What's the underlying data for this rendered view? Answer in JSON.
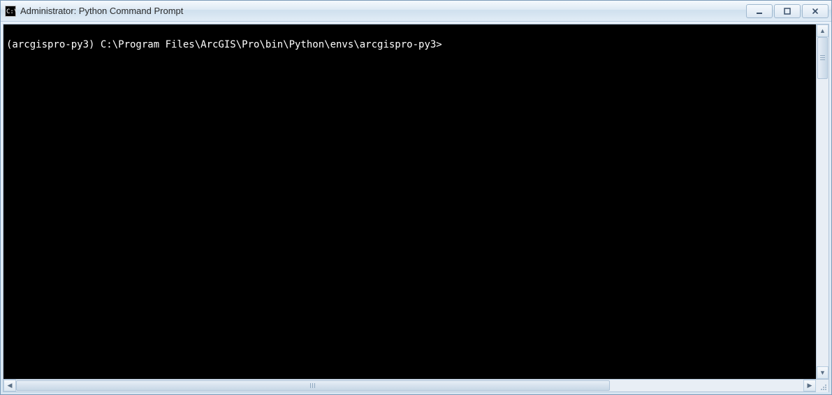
{
  "titlebar": {
    "title": "Administrator: Python Command Prompt"
  },
  "console": {
    "prompt": "(arcgispro-py3) C:\\Program Files\\ArcGIS\\Pro\\bin\\Python\\envs\\arcgispro-py3>"
  }
}
